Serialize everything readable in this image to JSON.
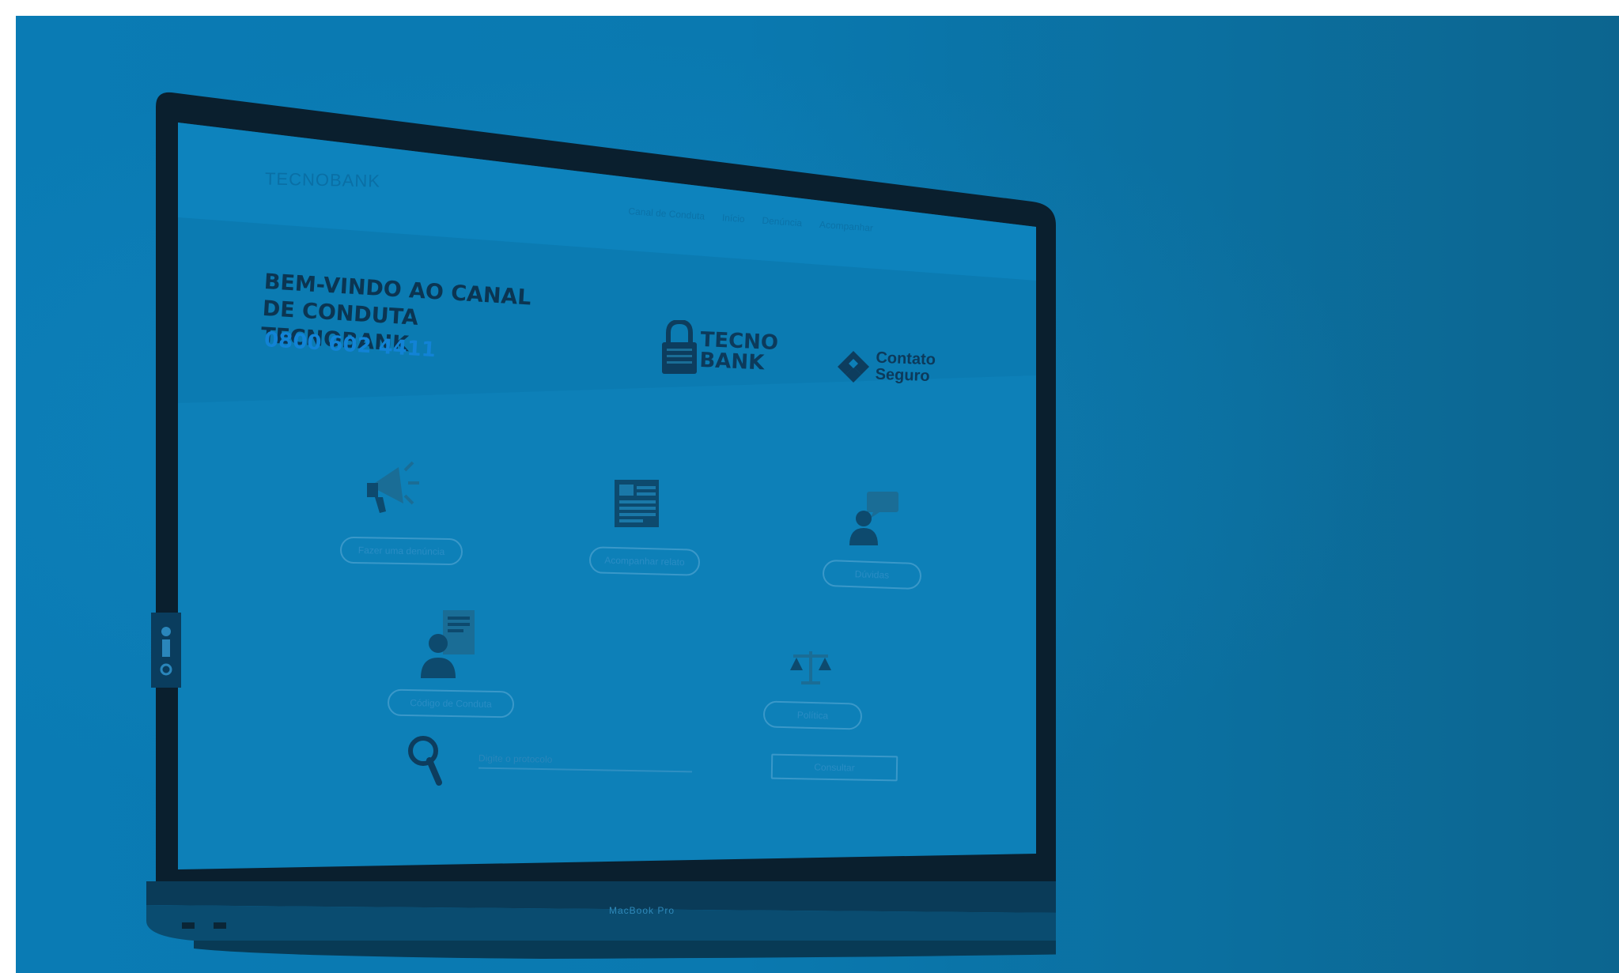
{
  "site": {
    "logo_text": "TECNOBANK",
    "nav": [
      "Canal de Conduta",
      "Início",
      "Denúncia",
      "Acompanhar"
    ],
    "hero": {
      "title": "BEM-VINDO AO CANAL DE CONDUTA TECNOBANK",
      "phone": "0800 602 4411"
    },
    "partner_logos": {
      "tecnobank": "TECNO\nBANK",
      "contato_seguro": "Contato\nSeguro"
    },
    "actions": [
      {
        "label": "Fazer uma denúncia",
        "icon": "megaphone-icon"
      },
      {
        "label": "Acompanhar relato",
        "icon": "document-list-icon"
      },
      {
        "label": "Dúvidas",
        "icon": "chat-person-icon"
      },
      {
        "label": "Código de Conduta",
        "icon": "person-document-icon"
      },
      {
        "label": "Política",
        "icon": "balance-icon"
      }
    ],
    "search": {
      "placeholder": "Digite o protocolo",
      "button_label": "Consultar"
    },
    "device_label": "MacBook Pro"
  },
  "colors": {
    "background_blue": "#0a7bb4",
    "overlay_blue": "#0a79b0",
    "dark_navy": "#0b3552",
    "phone_blue": "#1283d6"
  }
}
